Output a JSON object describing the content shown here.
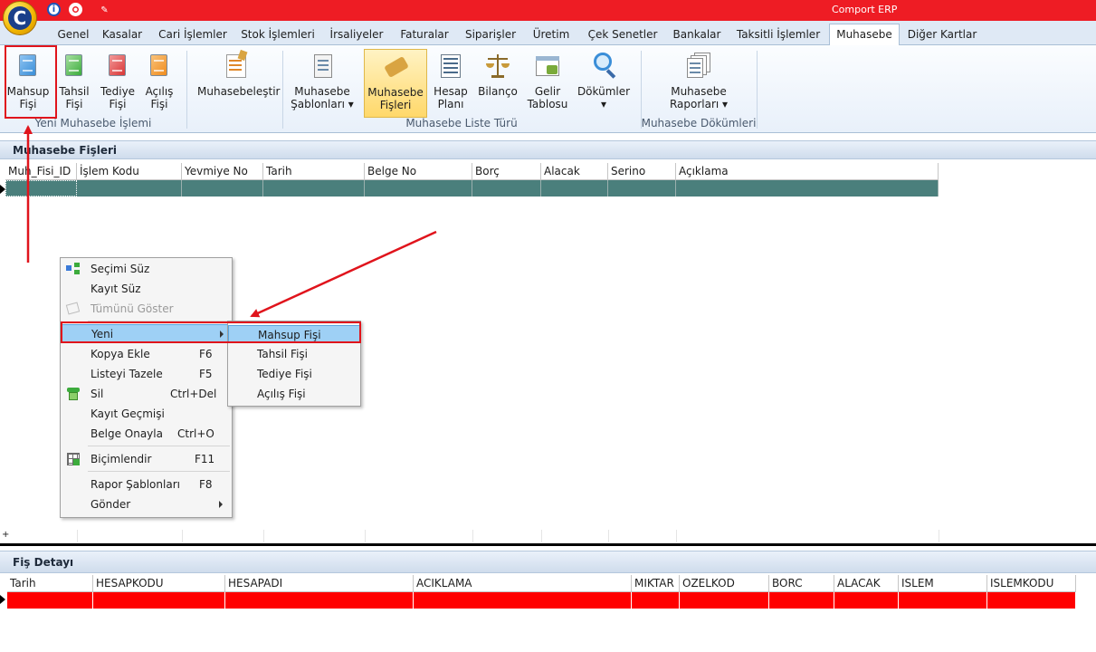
{
  "window": {
    "title": "Comport ERP"
  },
  "quick_access": [
    "info-icon",
    "help-icon",
    "pin-icon"
  ],
  "tabs": [
    {
      "label": "Genel",
      "active": false
    },
    {
      "label": "Kasalar",
      "active": false
    },
    {
      "label": "Cari İşlemler",
      "active": false
    },
    {
      "label": "Stok İşlemleri",
      "active": false
    },
    {
      "label": "İrsaliyeler",
      "active": false
    },
    {
      "label": "Faturalar",
      "active": false
    },
    {
      "label": "Siparişler",
      "active": false
    },
    {
      "label": "Üretim",
      "active": false
    },
    {
      "label": "Çek Senetler",
      "active": false
    },
    {
      "label": "Bankalar",
      "active": false
    },
    {
      "label": "Taksitli İşlemler",
      "active": false
    },
    {
      "label": "Muhasebe",
      "active": true
    },
    {
      "label": "Diğer Kartlar",
      "active": false
    }
  ],
  "ribbon": {
    "groups": [
      {
        "label": "Yeni Muhasebe İşlemi"
      },
      {
        "label": "Muhasebe Liste Türü"
      },
      {
        "label": "Muhasebe Dökümleri"
      }
    ],
    "buttons": [
      {
        "line1": "Mahsup",
        "line2": "Fişi",
        "icon": "mahsup-fisi-icon",
        "color": "#3a8ed8"
      },
      {
        "line1": "Tahsil",
        "line2": "Fişi",
        "icon": "tahsil-fisi-icon",
        "color": "#3cab3c"
      },
      {
        "line1": "Tediye",
        "line2": "Fişi",
        "icon": "tediye-fisi-icon",
        "color": "#d93535"
      },
      {
        "line1": "Açılış",
        "line2": "Fişi",
        "icon": "acilis-fisi-icon",
        "color": "#f08c1e"
      },
      {
        "line1": "Muhasebeleştir",
        "line2": "",
        "icon": "muhasebelestir-icon"
      },
      {
        "line1": "Muhasebe",
        "line2": "Şablonları ▾",
        "icon": "sablonlar-icon"
      },
      {
        "line1": "Muhasebe",
        "line2": "Fişleri",
        "icon": "muhasebe-fisleri-icon",
        "selected": true
      },
      {
        "line1": "Hesap",
        "line2": "Planı",
        "icon": "hesap-plani-icon"
      },
      {
        "line1": "Bilanço",
        "line2": "",
        "icon": "bilanco-icon"
      },
      {
        "line1": "Gelir",
        "line2": "Tablosu",
        "icon": "gelir-tablosu-icon"
      },
      {
        "line1": "Dökümler",
        "line2": "▾",
        "icon": "dokumler-icon"
      },
      {
        "line1": "Muhasebe",
        "line2": "Raporları ▾",
        "icon": "raporlar-icon"
      }
    ]
  },
  "panel1": {
    "title": "Muhasebe Fişleri",
    "columns": [
      "Muh_Fisi_ID",
      "İşlem Kodu",
      "Yevmiye No",
      "Tarih",
      "Belge No",
      "Borç",
      "Alacak",
      "Serino",
      "Açıklama"
    ],
    "row_color": "#4a7f7c"
  },
  "panel2": {
    "title": "Fiş Detayı",
    "columns": [
      "Tarih",
      "HESAPKODU",
      "HESAPADI",
      "ACIKLAMA",
      "MIKTAR",
      "OZELKOD",
      "BORC",
      "ALACAK",
      "ISLEM",
      "ISLEMKODU"
    ],
    "row_color": "#ff0000"
  },
  "context_menu": {
    "items": [
      {
        "label": "Seçimi Süz",
        "shortcut": "",
        "icon": "filter-selection-icon",
        "disabled": false
      },
      {
        "label": "Kayıt Süz",
        "shortcut": "",
        "icon": "",
        "disabled": false
      },
      {
        "label": "Tümünü Göster",
        "shortcut": "",
        "icon": "show-all-icon",
        "disabled": true
      },
      {
        "label": "Yeni",
        "shortcut": "",
        "icon": "",
        "disabled": false,
        "submenu": true,
        "hover": true
      },
      {
        "label": "Kopya Ekle",
        "shortcut": "F6",
        "icon": "",
        "disabled": false
      },
      {
        "label": "Listeyi Tazele",
        "shortcut": "F5",
        "icon": "",
        "disabled": false
      },
      {
        "label": "Sil",
        "shortcut": "Ctrl+Del",
        "icon": "delete-icon",
        "disabled": false
      },
      {
        "label": "Kayıt Geçmişi",
        "shortcut": "",
        "icon": "",
        "disabled": false
      },
      {
        "label": "Belge Onayla",
        "shortcut": "Ctrl+O",
        "icon": "",
        "disabled": false
      },
      {
        "label": "Biçimlendir",
        "shortcut": "F11",
        "icon": "format-icon",
        "disabled": false
      },
      {
        "label": "Rapor Şablonları",
        "shortcut": "F8",
        "icon": "",
        "disabled": false
      },
      {
        "label": "Gönder",
        "shortcut": "",
        "icon": "",
        "disabled": false,
        "submenu": true
      }
    ]
  },
  "submenu": {
    "items": [
      {
        "label": "Mahsup Fişi",
        "hover": true
      },
      {
        "label": "Tahsil Fişi"
      },
      {
        "label": "Tediye Fişi"
      },
      {
        "label": "Açılış Fişi"
      }
    ]
  },
  "annotation_color": "#e0141c"
}
